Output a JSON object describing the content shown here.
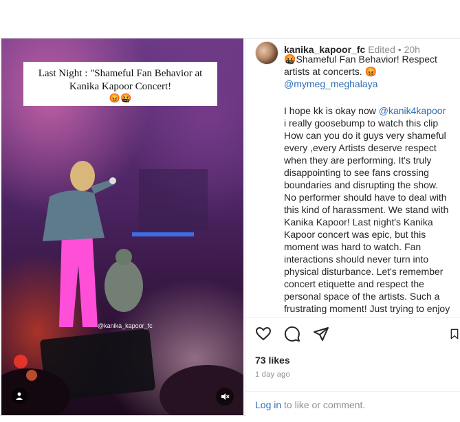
{
  "media": {
    "overlay_line1": "Last Night : \"Shameful Fan Behavior at",
    "overlay_line2": "Kanika Kapoor Concert!",
    "overlay_emoji": "😡🤬",
    "watermark": "@kanika_kapoor_fc"
  },
  "post": {
    "username": "kanika_kapoor_fc",
    "edited": "Edited",
    "separator": "•",
    "time": "20h",
    "caption_emoji": "🤬",
    "caption": "Shameful Fan Behavior! Respect artists at concerts.",
    "caption_end_emoji": "😡",
    "mention": "@mymeg_meghalaya"
  },
  "comment": {
    "line1_pre": "I hope kk is okay now",
    "mention": "@kanik4kapoor",
    "line1_post": "i really goosebump to watch this clip How can you do it guys very shameful every ,every Artists deserve respect when they are performing. It's truly disappointing to see fans crossing boundaries and disrupting the show. No performer should have to deal with this kind of harassment. We stand with Kanika Kapoor! Last night's Kanika Kapoor concert was epic, but this moment was hard to watch. Fan interactions should never turn into physical disturbance. Let's remember concert etiquette and respect the personal space of the artists. Such a frustrating moment! Just trying to enjoy"
  },
  "actions": {
    "likes": "73 likes",
    "date": "1 day ago",
    "login_link": "Log in",
    "login_text": "to like or comment."
  },
  "icons": [
    "heart-icon",
    "comment-icon",
    "share-icon",
    "save-icon",
    "person-icon",
    "mute-icon"
  ],
  "colors": {
    "link": "#2c6fb7",
    "muted": "#8e8e8e",
    "text": "#262626"
  }
}
